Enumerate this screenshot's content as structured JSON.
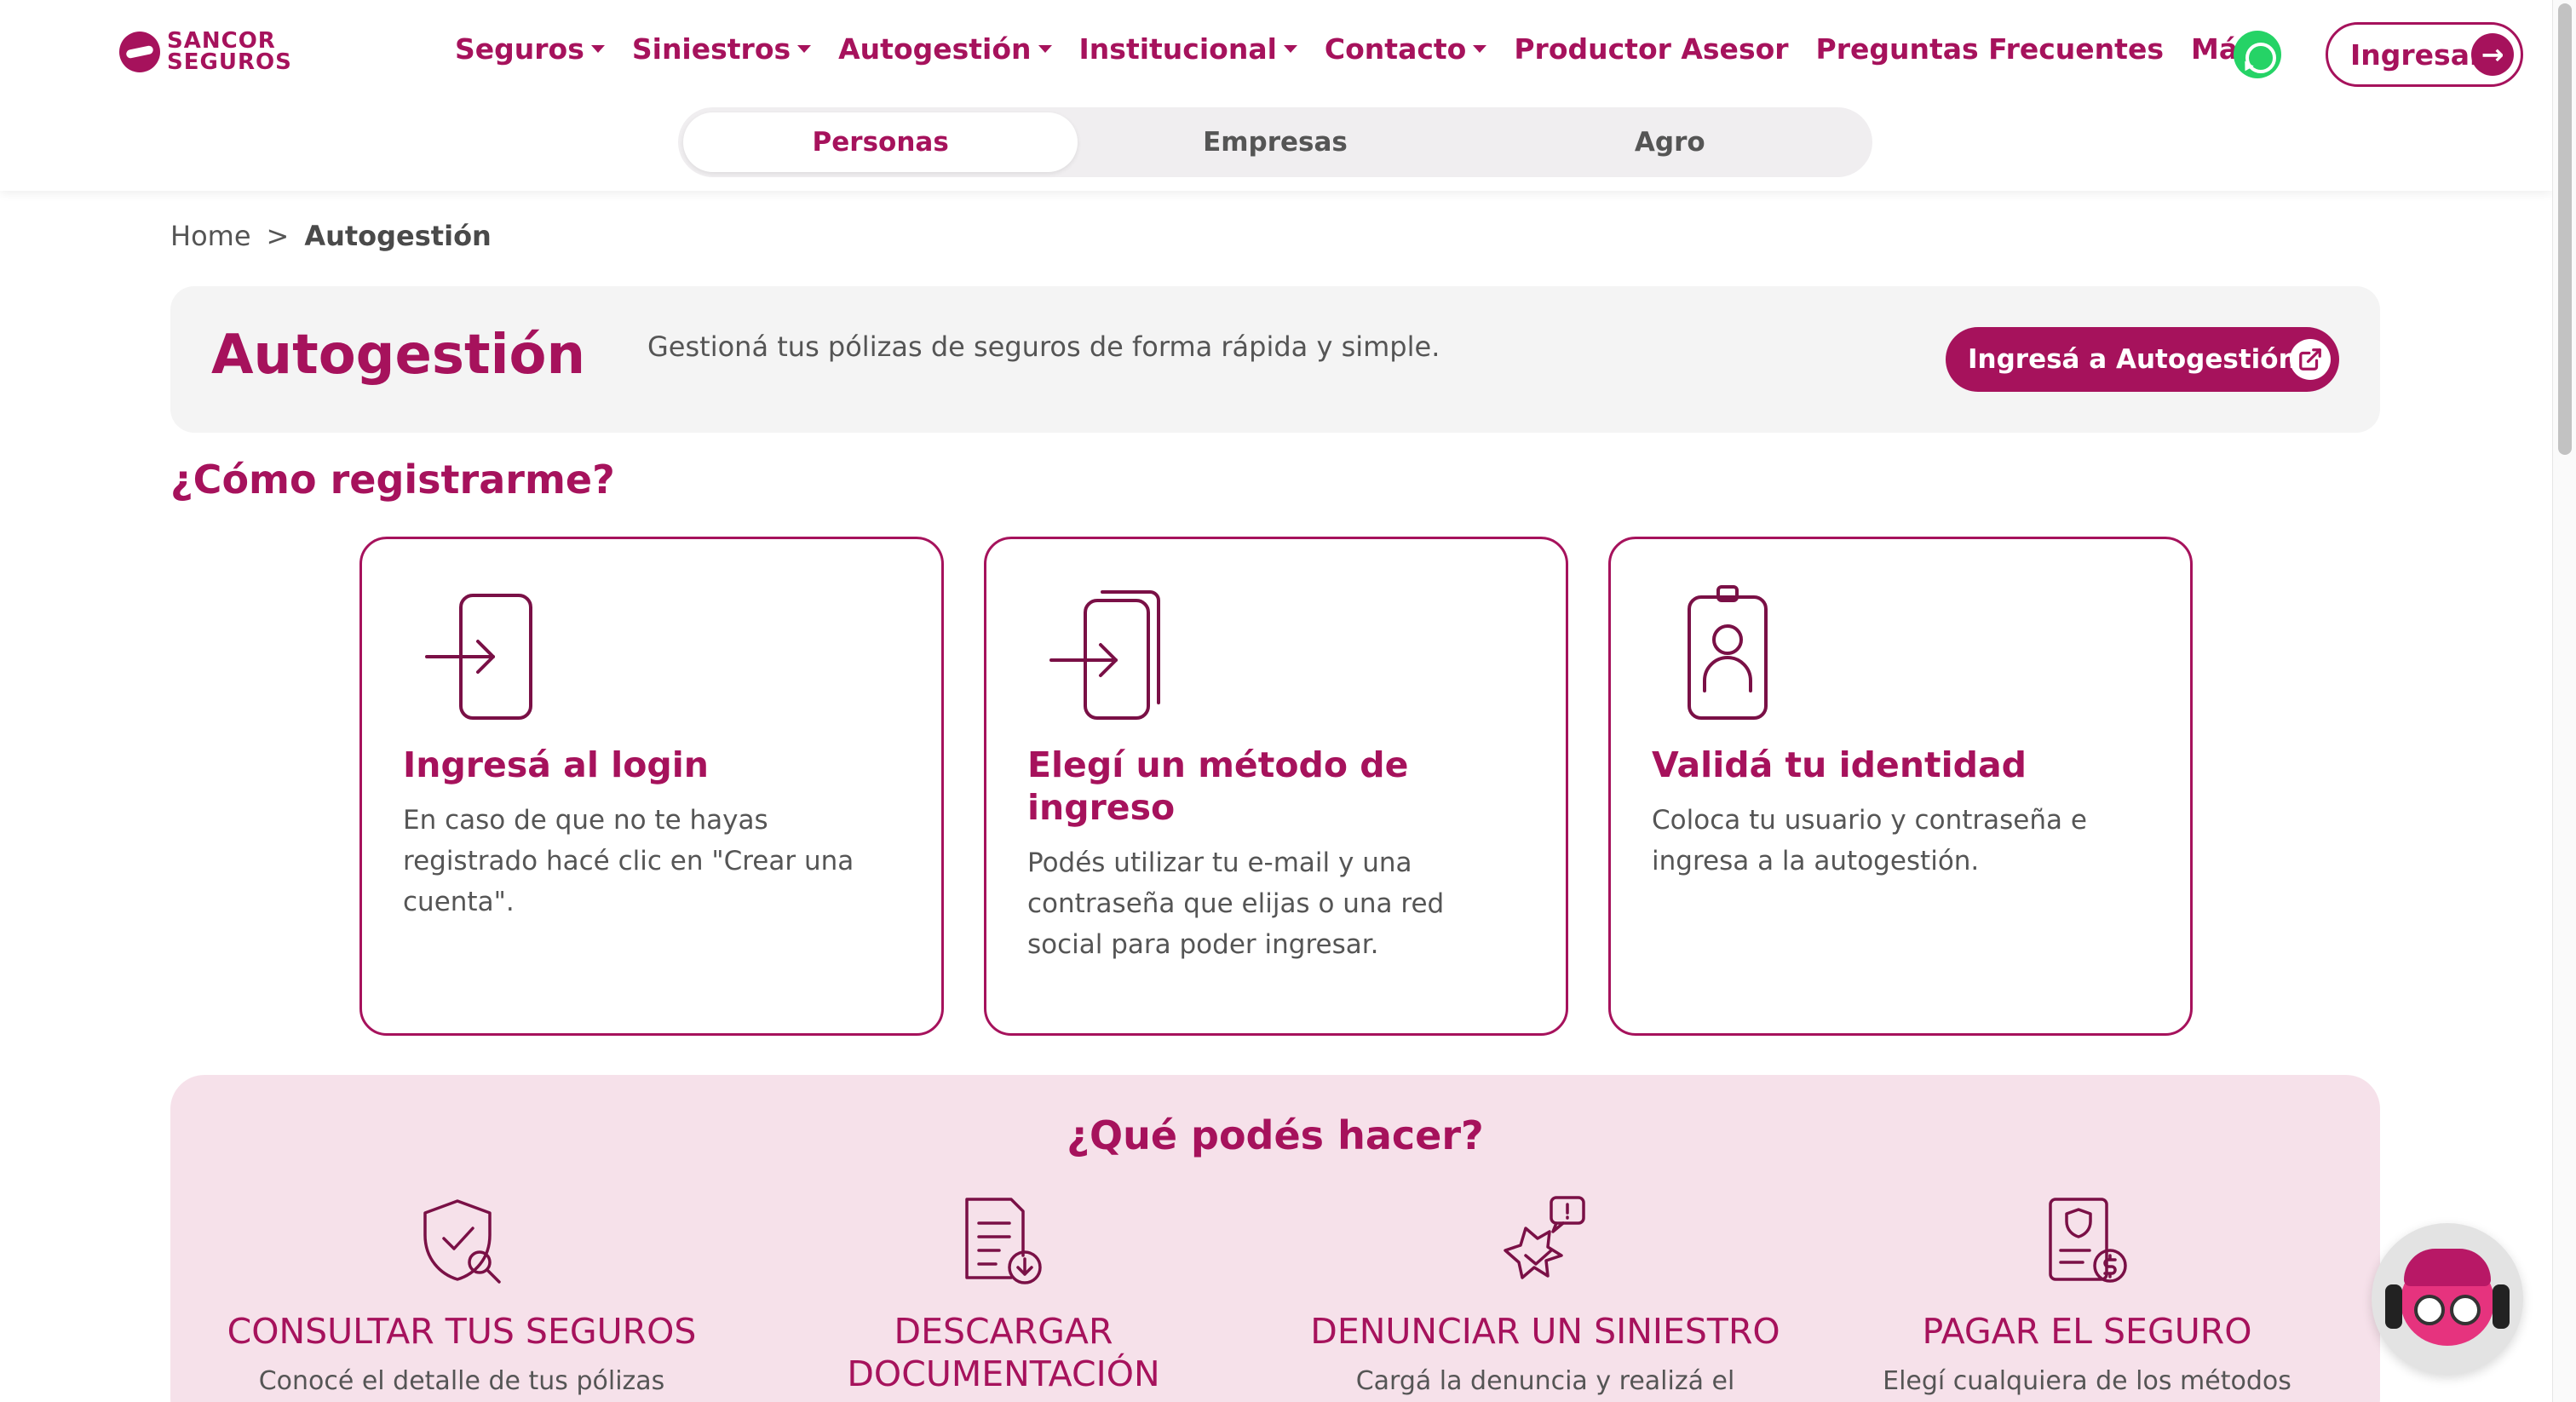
{
  "brand": {
    "logo_line1": "SANCOR",
    "logo_line2": "SEGUROS",
    "accent": "#a6125c",
    "panel_pink": "#f6e1ea"
  },
  "nav": {
    "items": [
      {
        "label": "Seguros",
        "dropdown": true
      },
      {
        "label": "Siniestros",
        "dropdown": true
      },
      {
        "label": "Autogestión",
        "dropdown": true
      },
      {
        "label": "Institucional",
        "dropdown": true
      },
      {
        "label": "Contacto",
        "dropdown": true
      },
      {
        "label": "Productor Asesor",
        "dropdown": false
      },
      {
        "label": "Preguntas Frecuentes",
        "dropdown": false
      },
      {
        "label": "Más",
        "dropdown": true
      }
    ],
    "whatsapp_icon": "whatsapp-icon",
    "login_label": "Ingresar"
  },
  "segments": {
    "tabs": [
      "Personas",
      "Empresas",
      "Agro"
    ],
    "active": "Personas"
  },
  "breadcrumb": {
    "home": "Home",
    "separator": ">",
    "current": "Autogestión"
  },
  "banner": {
    "title": "Autogestión",
    "description": "Gestioná tus pólizas de seguros de forma rápida y simple.",
    "button_label": "Ingresá a Autogestión"
  },
  "register": {
    "title": "¿Cómo registrarme?",
    "steps": [
      {
        "icon": "login-door-icon",
        "title": "Ingresá al login",
        "description": "En caso de que no te hayas registrado hacé clic en \"Crear una cuenta\"."
      },
      {
        "icon": "login-method-icon",
        "title": "Elegí un método de ingreso",
        "description": "Podés utilizar tu e-mail y una contraseña que elijas o una red social para poder ingresar."
      },
      {
        "icon": "id-badge-icon",
        "title": "Validá tu identidad",
        "description": "Coloca tu usuario y contraseña e ingresa a la autogestión."
      }
    ]
  },
  "features": {
    "title": "¿Qué podés hacer?",
    "items": [
      {
        "icon": "shield-search-icon",
        "title": "CONSULTAR TUS SEGUROS",
        "description": "Conocé el detalle de tus pólizas"
      },
      {
        "icon": "document-download-icon",
        "title": "DESCARGAR DOCUMENTACIÓN",
        "description": ""
      },
      {
        "icon": "car-crash-icon",
        "title": "DENUNCIAR UN SINIESTRO",
        "description": "Cargá la denuncia y realizá el"
      },
      {
        "icon": "invoice-dollar-icon",
        "title": "PAGAR EL SEGURO",
        "description": "Elegí cualquiera de los métodos"
      }
    ]
  },
  "chatbot": {
    "icon": "chatbot-avatar-icon"
  }
}
